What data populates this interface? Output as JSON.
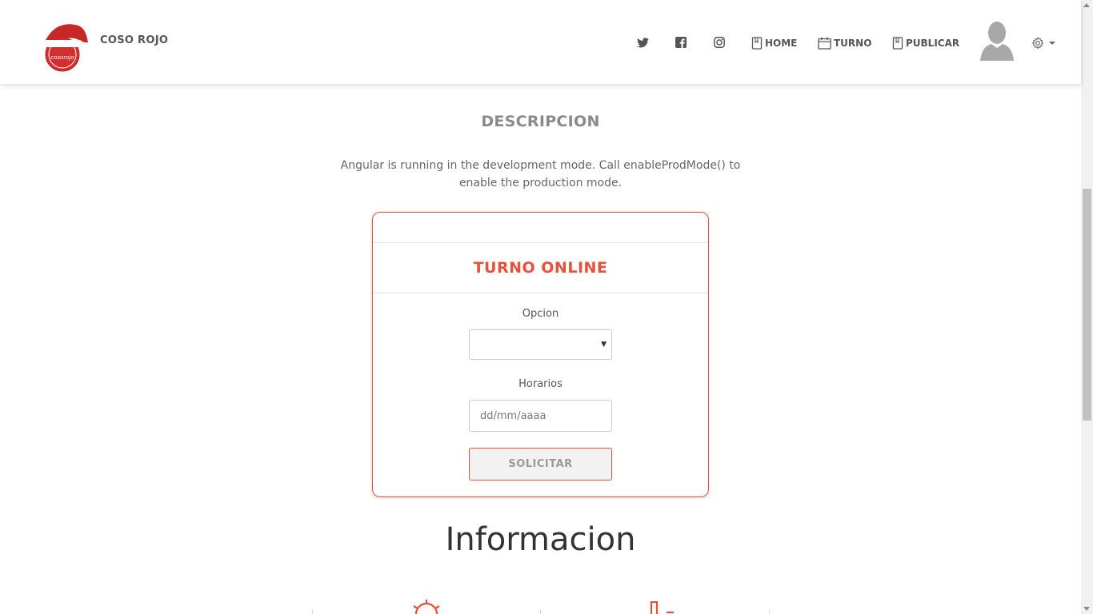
{
  "brand": {
    "name": "COSO ROJO",
    "logo_text": "cosorojo"
  },
  "nav": {
    "social": [
      {
        "icon": "twitter-icon"
      },
      {
        "icon": "facebook-icon"
      },
      {
        "icon": "instagram-icon"
      }
    ],
    "links": [
      {
        "label": "HOME",
        "icon": "book-icon"
      },
      {
        "label": "TURNO",
        "icon": "calendar-icon"
      },
      {
        "label": "PUBLICAR",
        "icon": "book-icon"
      }
    ],
    "settings_icon": "gear-icon"
  },
  "description": {
    "title": "DESCRIPCION",
    "text": "Angular is running in the development mode. Call enableProdMode() to enable the production mode."
  },
  "turno_form": {
    "title": "TURNO ONLINE",
    "opcion_label": "Opcion",
    "opcion_value": "",
    "horarios_label": "Horarios",
    "horarios_placeholder": "dd/mm/aaaa",
    "submit_label": "SOLICITAR"
  },
  "info": {
    "title": "Informacion"
  },
  "colors": {
    "accent": "#e8503a",
    "text": "#555555",
    "muted": "#8a8a8a"
  }
}
